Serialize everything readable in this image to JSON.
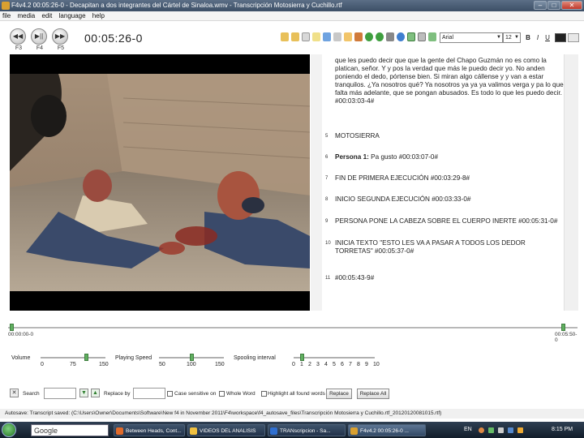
{
  "window": {
    "title": "F4v4.2 00:05:26-0 - Decapitan a dos integrantes del Cártel de Sinaloa.wmv - Transcripción Motosierra y Cuchillo.rtf"
  },
  "menu": {
    "items": [
      "file",
      "media",
      "edit",
      "language",
      "help"
    ]
  },
  "player": {
    "timecode": "00:05:26-0",
    "buttons": [
      {
        "symbol": "◀◀",
        "key": "F3"
      },
      {
        "symbol": "▶||",
        "key": "F4"
      },
      {
        "symbol": "▶▶",
        "key": "F5"
      }
    ]
  },
  "editor": {
    "font": "Arial",
    "font_size": "12",
    "bold": "B",
    "italic": "I",
    "underline": "U"
  },
  "transcript": {
    "segments": [
      {
        "num": "",
        "html": "que les puedo decir que que la gente del Chapo Guzmán no es como la platican, señor. Y y pos la verdad que más le puedo decir yo. No anden poniendo el dedo, pórtense bien. Si miran algo cállense y  y van a estar tranquilos. ¿Ya nosotros qué? Ya nosotros ya ya ya valimos verga y pa lo que falta más adelante, que se pongan abusados. Es todo lo que les puedo decir. #00:03:03-4#"
      },
      {
        "num": "5",
        "html": "MOTOSIERRA"
      },
      {
        "num": "6",
        "html": "<b>Persona 1:</b> Pa gusto #00:03:07-0#"
      },
      {
        "num": "7",
        "html": "FIN DE PRIMERA EJECUCIÓN #00:03:29-8#"
      },
      {
        "num": "8",
        "html": "INICIO SEGUNDA EJECUCIÓN #00:03:33-0#"
      },
      {
        "num": "9",
        "html": "PERSONA PONE LA CABEZA SOBRE EL CUERPO INERTE #00:05:31-0#"
      },
      {
        "num": "10",
        "html": "INICIA TEXTO \"ESTO LES VA A PASAR A TODOS LOS DEDOR TORRETAS\" #00:05:37-0#"
      },
      {
        "num": "11",
        "html": "#00:05:43-9#"
      }
    ]
  },
  "timeline": {
    "start": "00:00:00-0",
    "end": "00:05:50-0",
    "position": 0.98
  },
  "sliders": {
    "volume": {
      "label": "Volume",
      "ticks": [
        "0",
        "75",
        "150"
      ],
      "value": 105
    },
    "speed": {
      "label": "Playing Speed",
      "ticks": [
        "50",
        "100",
        "150"
      ],
      "value": 100
    },
    "spooling": {
      "label": "Spooling interval",
      "ticks": [
        "0",
        "1",
        "2",
        "3",
        "4",
        "5",
        "6",
        "7",
        "8",
        "9",
        "10"
      ],
      "value": 1
    }
  },
  "search": {
    "search_label": "Search",
    "replace_label": "Replace by",
    "case_sensitive_label": "Case sensitive on",
    "whole_word_label": "Whole Word",
    "highlight_label": "Highlight all found words",
    "replace_button": "Replace",
    "replace_all_button": "Replace All"
  },
  "status": {
    "text": "Autosave: Transcript saved: (C:\\Users\\Owner\\Documents\\Software\\New f4 in November 2011\\F4\\workspace\\f4_autosave_files\\Transcripción Motosierra y Cuchillo.rtf_20120120081015.rtf)"
  },
  "taskbar": {
    "google_label": "Google",
    "items": [
      {
        "label": "Between Heads, Cont...",
        "color": "#e06a2a"
      },
      {
        "label": "VIDEOS DEL ANALISIS",
        "color": "#f0c040"
      },
      {
        "label": "TRANscripcion - Sa...",
        "color": "#2f6fd0"
      },
      {
        "label": "F4v4.2 00:05:26-0 ...",
        "color": "#d9a030"
      }
    ],
    "language": "EN",
    "clock": "8:15 PM"
  },
  "colors": {
    "accent_green": "#5fae5f",
    "title_bar": "#3c4f66",
    "taskbar": "#1b2838"
  }
}
